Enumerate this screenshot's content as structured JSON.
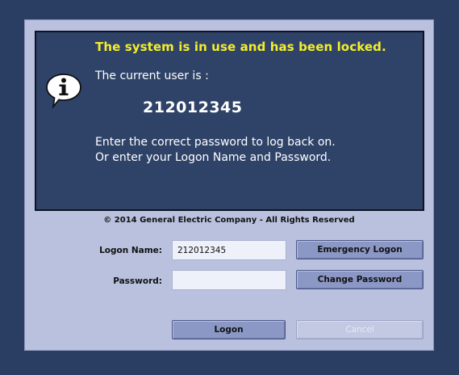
{
  "lock_message": {
    "title": "The system is in use and has been locked.",
    "current_user_label": "The current user is :",
    "current_user_value": "212012345",
    "instruction_line1": "Enter the correct password to log back on.",
    "instruction_line2": "Or enter your Logon Name and Password.",
    "icon": "info-icon"
  },
  "copyright": "© 2014 General Electric Company - All Rights Reserved",
  "form": {
    "logon_name_label": "Logon Name:",
    "logon_name_value": "212012345",
    "password_label": "Password:",
    "password_value": ""
  },
  "buttons": {
    "emergency_logon": "Emergency Logon",
    "change_password": "Change Password",
    "logon": "Logon",
    "cancel": "Cancel"
  },
  "colors": {
    "background": "#2a3d63",
    "dialog": "#b9c1de",
    "message_panel": "#2f4369",
    "title_text": "#f4ee27",
    "button": "#8b97c5"
  }
}
